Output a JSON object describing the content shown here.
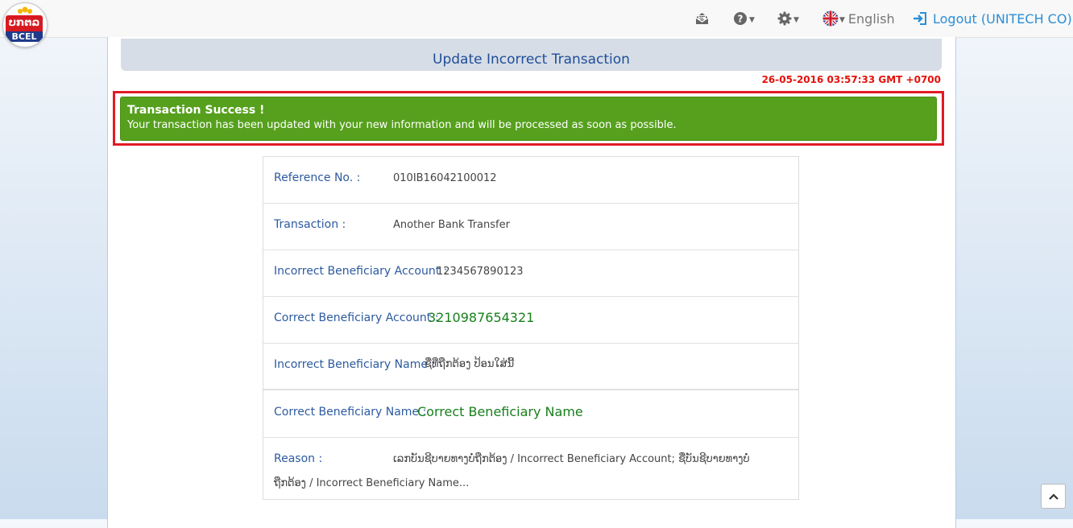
{
  "logo": {
    "lao_text": "ບກຕລ",
    "brand": "BCEL"
  },
  "nav": {
    "language": "English",
    "logout": "Logout (UNITECH CO)"
  },
  "page": {
    "title": "Update Incorrect Transaction",
    "timestamp": "26-05-2016 03:57:33 GMT +0700"
  },
  "alert": {
    "title": "Transaction Success !",
    "message": "Your transaction has been updated with your new information and will be processed as soon as possible."
  },
  "details": {
    "reference_label": "Reference No. :",
    "reference_value": "010IB16042100012",
    "transaction_label": "Transaction :",
    "transaction_value": "Another Bank Transfer",
    "incorrect_account_label": "Incorrect Beneficiary Account :",
    "incorrect_account_value": "1234567890123",
    "correct_account_label": "Correct Beneficiary Account :",
    "correct_account_value": "3210987654321",
    "incorrect_name_label": "Incorrect Beneficiary Name :",
    "incorrect_name_value": "ຊື່ທີ່ຖືກຕ້ອງ ປ້ອນໃສ່ນີ້",
    "correct_name_label": "Correct Beneficiary Name :",
    "correct_name_value": "Correct Beneficiary Name",
    "reason_label": "Reason :",
    "reason_line1": "ເລກບັນຊີບາຍທາງບໍ່ຖືກຕ້ອງ / Incorrect Beneficiary Account; ຊື່ບັນຊີບາຍທາງບໍ່",
    "reason_line2": "ຖືກຕ້ອງ / Incorrect Beneficiary Name..."
  },
  "colors": {
    "accent": "#1f4e99",
    "success": "#56a01d",
    "highlight_border": "#e11b24",
    "timestamp": "#e3120b",
    "value_green": "#17801b"
  },
  "icons": [
    "mail-icon",
    "help-icon",
    "settings-icon",
    "uk-flag-icon",
    "logout-icon",
    "chevron-up-icon"
  ]
}
